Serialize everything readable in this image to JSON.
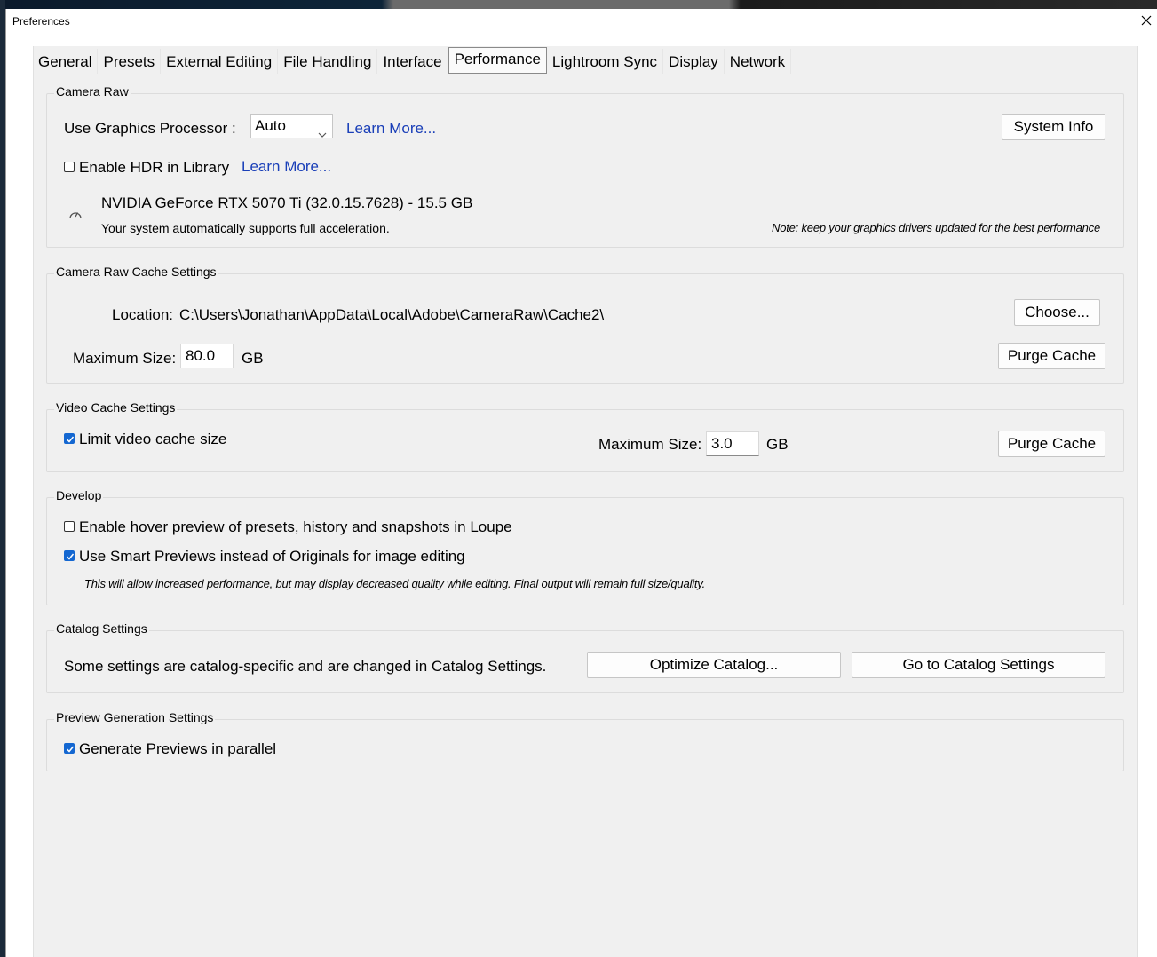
{
  "window": {
    "title": "Preferences"
  },
  "tabs": [
    {
      "label": "General"
    },
    {
      "label": "Presets"
    },
    {
      "label": "External Editing"
    },
    {
      "label": "File Handling"
    },
    {
      "label": "Interface"
    },
    {
      "label": "Performance",
      "active": true
    },
    {
      "label": "Lightroom Sync"
    },
    {
      "label": "Display"
    },
    {
      "label": "Network"
    }
  ],
  "camera_raw": {
    "title": "Camera Raw",
    "gpu_label": "Use Graphics Processor :",
    "gpu_value": "Auto",
    "learn_more": "Learn More...",
    "system_info": "System Info",
    "hdr_label": "Enable HDR in Library",
    "hdr_checked": false,
    "hdr_learn_more": "Learn More...",
    "gpu_name": "NVIDIA GeForce RTX 5070 Ti (32.0.15.7628) - 15.5 GB",
    "gpu_status": "Your system automatically supports full acceleration.",
    "driver_note": "Note: keep your graphics drivers updated for the best performance"
  },
  "cache": {
    "title": "Camera Raw Cache Settings",
    "location_label": "Location:",
    "location_value": "C:\\Users\\Jonathan\\AppData\\Local\\Adobe\\CameraRaw\\Cache2\\",
    "choose": "Choose...",
    "max_label": "Maximum Size:",
    "max_value": "80.0",
    "unit": "GB",
    "purge": "Purge Cache"
  },
  "video_cache": {
    "title": "Video Cache Settings",
    "limit_label": "Limit video cache size",
    "limit_checked": true,
    "max_label": "Maximum Size:",
    "max_value": "3.0",
    "unit": "GB",
    "purge": "Purge Cache"
  },
  "develop": {
    "title": "Develop",
    "hover_label": "Enable hover preview of presets, history and snapshots in Loupe",
    "hover_checked": false,
    "smart_label": "Use Smart Previews instead of Originals for image editing",
    "smart_checked": true,
    "smart_note": "This will allow increased performance, but may display decreased quality while editing. Final output will remain full size/quality."
  },
  "catalog": {
    "title": "Catalog Settings",
    "desc": "Some settings are catalog-specific and are changed in Catalog Settings.",
    "optimize": "Optimize Catalog...",
    "goto": "Go to Catalog Settings"
  },
  "preview": {
    "title": "Preview Generation Settings",
    "parallel_label": "Generate Previews in parallel",
    "parallel_checked": true
  },
  "colors": {
    "link": "#1a3fb8",
    "checkbox": "#1467d1"
  }
}
